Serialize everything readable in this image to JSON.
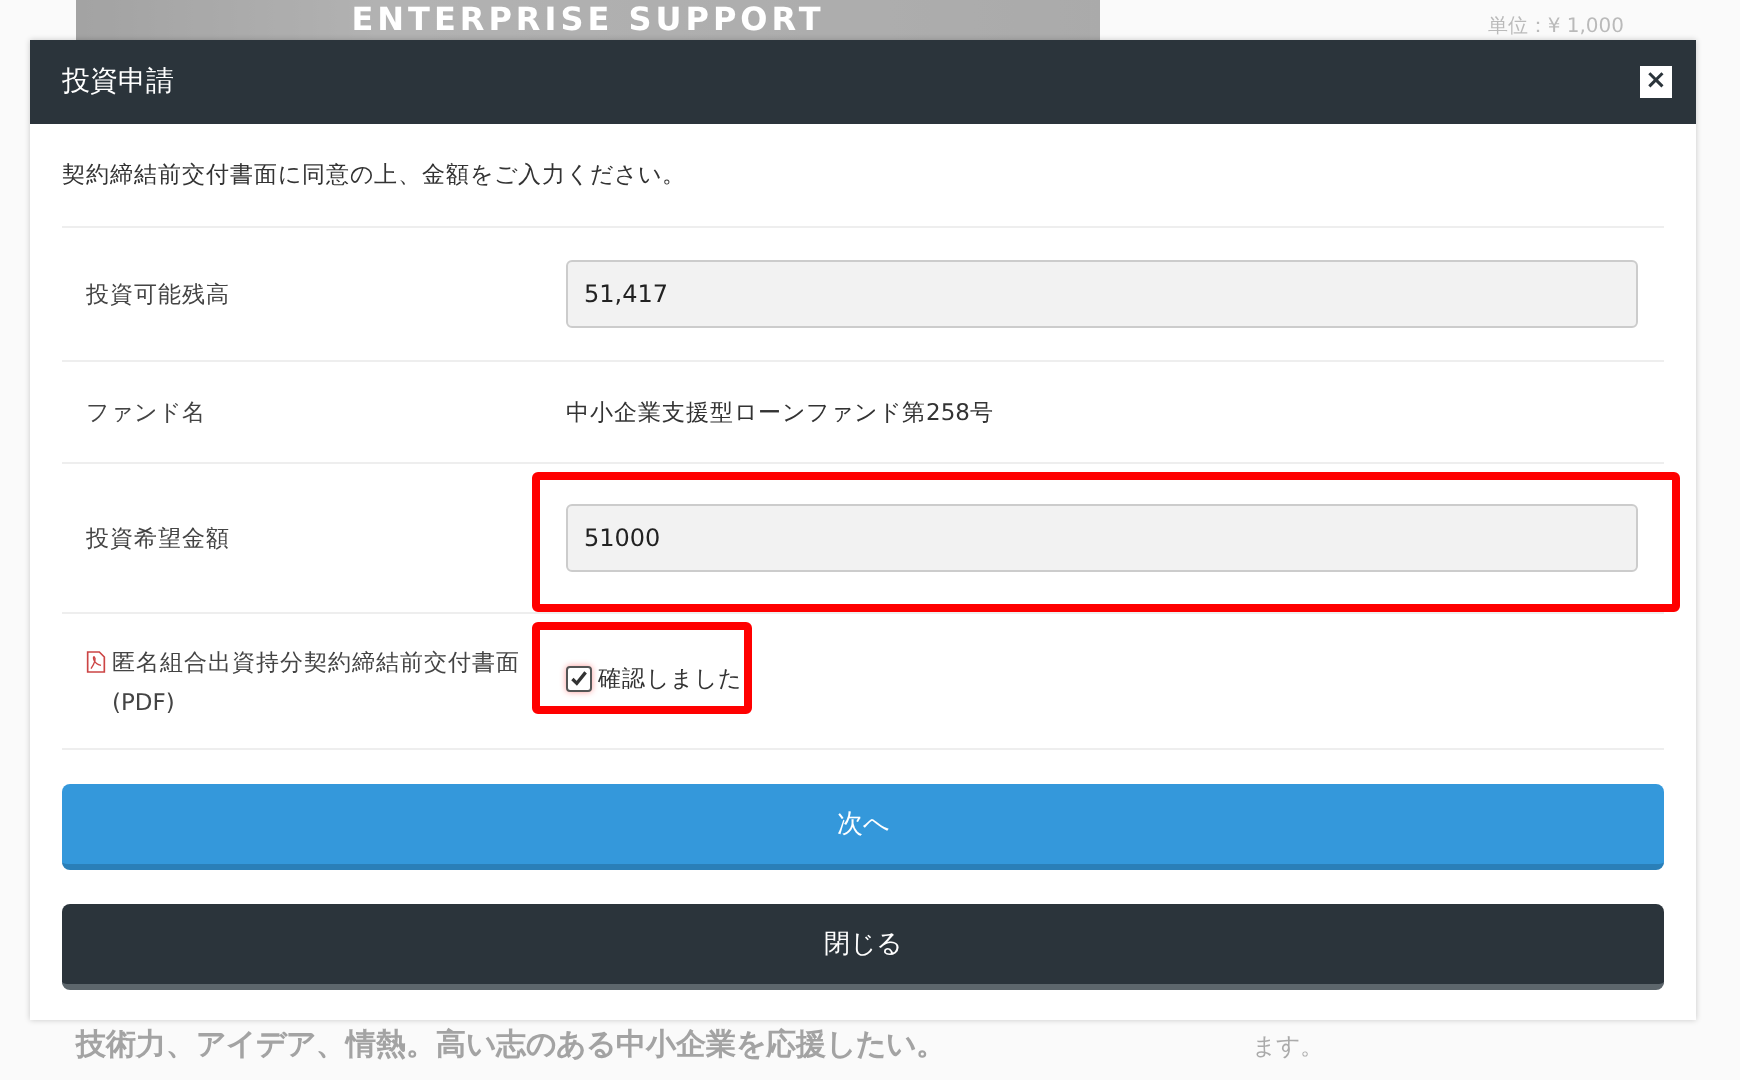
{
  "background_page": {
    "banner": "ENTERPRISE SUPPORT",
    "unit": "単位：¥ 1,000",
    "heading": "技術力、アイデア、情熱。高い志のある中小企業を応援したい。",
    "side_note": "ます。"
  },
  "modal": {
    "title": "投資申請",
    "close_icon": "×",
    "intro": "契約締結前交付書面に同意の上、金額をご入力ください。",
    "rows": [
      {
        "kind": "input",
        "label": "投資可能残高",
        "value": "51,417",
        "highlighted": false
      },
      {
        "kind": "text",
        "label": "ファンド名",
        "value": "中小企業支援型ローンファンド第258号",
        "highlighted": false
      },
      {
        "kind": "input",
        "label": "投資希望金額",
        "value": "51000",
        "highlighted": true
      },
      {
        "kind": "checkbox",
        "label": "匿名組合出資持分契約締結前交付書面(PDF)",
        "value": "確認しました",
        "checked": true,
        "highlighted": true
      }
    ],
    "buttons": [
      {
        "kind": "primary",
        "label": "次へ"
      },
      {
        "kind": "dark",
        "label": "閉じる"
      }
    ]
  }
}
